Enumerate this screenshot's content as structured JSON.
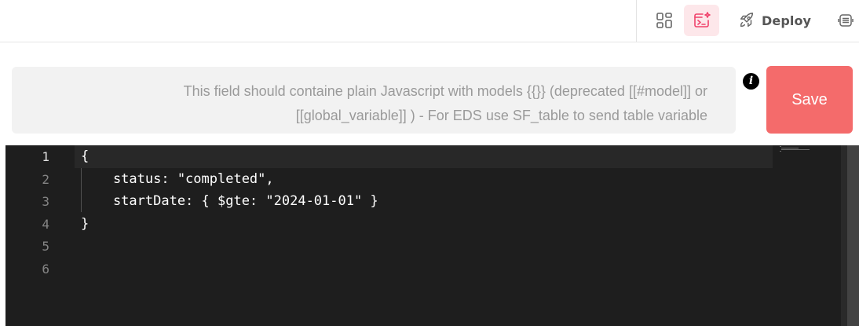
{
  "toolbar": {
    "deploy_label": "Deploy",
    "icons": [
      "layout-grid-icon",
      "code-edit-icon",
      "rocket-icon",
      "api-icon"
    ],
    "active_color": "#f0426b"
  },
  "hint": {
    "line1": "This field should containe plain Javascript with models {{}} (deprecated [[#model]] or",
    "line2": "[[global_variable]] ) - For EDS use SF_table to send table variable"
  },
  "info_icon_label": "i",
  "save_label": "Save",
  "editor": {
    "line_numbers": [
      "1",
      "2",
      "3",
      "4",
      "5",
      "6"
    ],
    "active_line": "1",
    "lines": [
      "{",
      "    status: \"completed\",",
      "    startDate: { $gte: \"2024-01-01\" }",
      "}",
      "",
      ""
    ]
  },
  "colors": {
    "save_button": "#f46b6b",
    "editor_background": "#1e1e1e",
    "hint_background": "#f2f2f2"
  }
}
